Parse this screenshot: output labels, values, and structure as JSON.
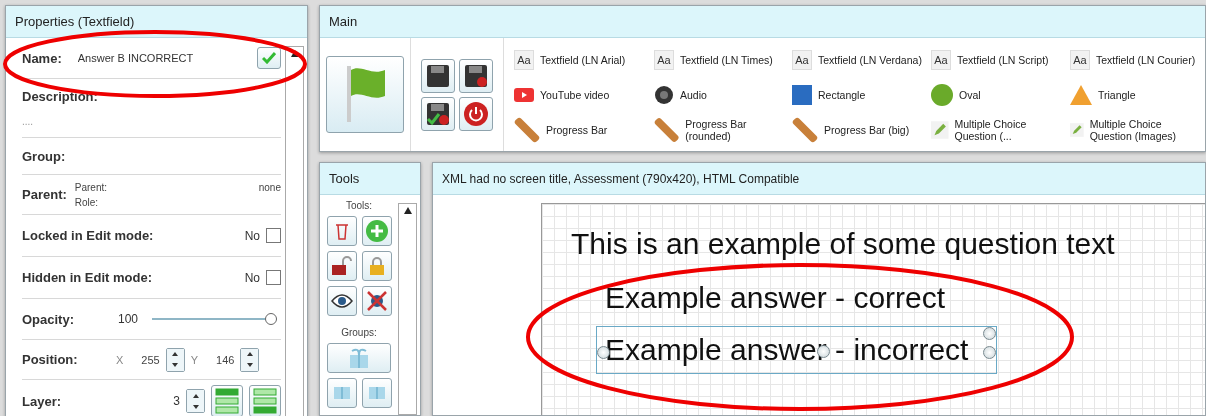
{
  "properties": {
    "title": "Properties (Textfield)",
    "rows": [
      {
        "kind": "name",
        "label": "Name:",
        "value": "Answer B INCORRECT"
      },
      {
        "kind": "description",
        "label": "Description:",
        "value": "...."
      },
      {
        "kind": "plain",
        "label": "Group:"
      },
      {
        "kind": "parent",
        "label": "Parent:",
        "parent_label": "Parent:",
        "parent_value": "none",
        "role_label": "Role:"
      },
      {
        "kind": "checkbox",
        "label": "Locked in Edit mode:",
        "value": "No",
        "checked": false
      },
      {
        "kind": "checkbox",
        "label": "Hidden in Edit mode:",
        "value": "No",
        "checked": false
      },
      {
        "kind": "slider",
        "label": "Opacity:",
        "value": "100",
        "level": 1
      },
      {
        "kind": "position",
        "label": "Position:",
        "x_label": "X",
        "x_value": "255",
        "y_label": "Y",
        "y_value": "146"
      },
      {
        "kind": "layer",
        "label": "Layer:",
        "value": "3"
      }
    ]
  },
  "main": {
    "title": "Main",
    "items": [
      {
        "kind": "textfield",
        "icon_text": "Aa",
        "label": "Textfield (LN Arial)"
      },
      {
        "kind": "textfield",
        "icon_text": "Aa",
        "label": "Textfield (LN Times)"
      },
      {
        "kind": "textfield",
        "icon_text": "Aa",
        "label": "Textfield (LN Verdana)"
      },
      {
        "kind": "textfield",
        "icon_text": "Aa",
        "label": "Textfield (LN Script)"
      },
      {
        "kind": "textfield",
        "icon_text": "Aa",
        "label": "Textfield (LN Courier)"
      },
      {
        "kind": "video",
        "label": "YouTube video"
      },
      {
        "kind": "audio",
        "label": "Audio"
      },
      {
        "kind": "rectangle",
        "label": "Rectangle"
      },
      {
        "kind": "oval",
        "label": "Oval"
      },
      {
        "kind": "triangle",
        "label": "Triangle"
      },
      {
        "kind": "progress",
        "label": "Progress Bar"
      },
      {
        "kind": "progress",
        "label": "Progress Bar (rounded)"
      },
      {
        "kind": "progress",
        "label": "Progress Bar (big)"
      },
      {
        "kind": "question",
        "label": "Multiple Choice Question (..."
      },
      {
        "kind": "question",
        "label": "Multiple Choice Question (Images)"
      }
    ]
  },
  "tools": {
    "title": "Tools",
    "tools_label": "Tools:",
    "groups_label": "Groups:"
  },
  "canvas": {
    "title": "XML had no screen title, Assessment (790x420), HTML Compatible",
    "texts": [
      {
        "text": "This is an example of some question text",
        "selected": false
      },
      {
        "text": "Example answer - correct",
        "selected": false
      },
      {
        "text": "Example answer - incorrect",
        "selected": true
      }
    ]
  }
}
